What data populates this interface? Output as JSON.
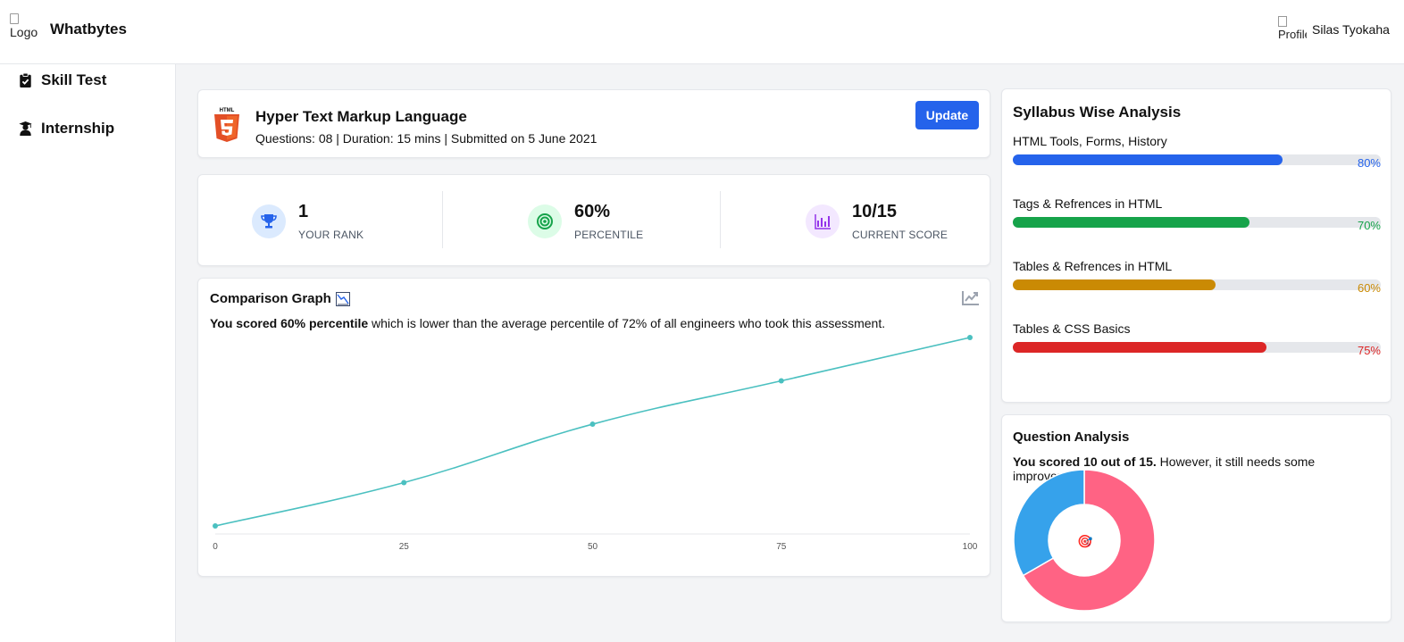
{
  "header": {
    "logo_alt": "Logo",
    "brand": "Whatbytes",
    "profile_alt": "Profile",
    "profile_name": "Silas Tyokaha"
  },
  "sidebar": {
    "items": [
      {
        "label": "Skill Test",
        "icon": "clipboard-check-icon"
      },
      {
        "label": "Internship",
        "icon": "graduate-icon"
      }
    ]
  },
  "topic": {
    "title": "Hyper Text Markup Language",
    "meta": "Questions: 08 | Duration: 15 mins | Submitted on 5 June 2021",
    "update_label": "Update",
    "logo_text": "HTML"
  },
  "stats": [
    {
      "value": "1",
      "label": "YOUR RANK",
      "icon": "trophy-icon",
      "bg": "#dbeafe",
      "fg": "#2563eb"
    },
    {
      "value": "60%",
      "label": "PERCENTILE",
      "icon": "target-icon",
      "bg": "#dcfce7",
      "fg": "#16a34a"
    },
    {
      "value": "10/15",
      "label": "CURRENT SCORE",
      "icon": "bar-chart-icon",
      "bg": "#f3e8ff",
      "fg": "#9333ea"
    }
  ],
  "graph": {
    "title": "Comparison Graph",
    "desc_bold": "You scored 60% percentile",
    "desc_rest": " which is lower than the average percentile of 72% of all engineers who took this assessment."
  },
  "chart_data": {
    "type": "line",
    "x": [
      0,
      25,
      50,
      75,
      100
    ],
    "series": [
      {
        "values": [
          0,
          23,
          54,
          77,
          100
        ]
      }
    ],
    "xticks": [
      "0",
      "25",
      "50",
      "75",
      "100"
    ],
    "line_color": "#4bc0c0",
    "grid": false
  },
  "syllabus": {
    "title": "Syllabus Wise Analysis",
    "items": [
      {
        "label": "HTML Tools, Forms, History",
        "value": 80,
        "pct": "80%",
        "color": "#2563eb"
      },
      {
        "label": "Tags & Refrences in HTML",
        "value": 70,
        "pct": "70%",
        "color": "#16a34a"
      },
      {
        "label": "Tables & Refrences in HTML",
        "value": 60,
        "pct": "60%",
        "color": "#ca8a04"
      },
      {
        "label": "Tables & CSS Basics",
        "value": 75,
        "pct": "75%",
        "color": "#dc2626"
      }
    ]
  },
  "question_analysis": {
    "title": "Question Analysis",
    "desc_bold": "You scored 10 out of 15.",
    "desc_rest": " However, it still needs some improvements.",
    "center_emoji": "🎯",
    "donut": {
      "correct": 10,
      "incorrect": 5,
      "correct_color": "#ff6384",
      "incorrect_color": "#36a2eb"
    }
  }
}
